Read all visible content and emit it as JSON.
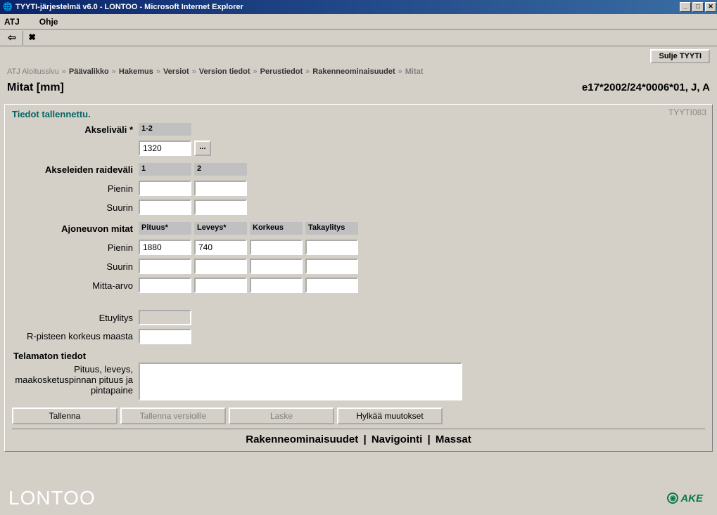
{
  "window": {
    "title": "TYYTI-järjestelmä v6.0 - LONTOO - Microsoft Internet Explorer"
  },
  "menu": {
    "atj": "ATJ",
    "ohje": "Ohje"
  },
  "top": {
    "sulje": "Sulje TYYTI"
  },
  "breadcrumb": {
    "items": [
      "ATJ Aloitussivu",
      "Päävalikko",
      "Hakemus",
      "Versiot",
      "Version tiedot",
      "Perustiedot",
      "Rakenneominaisuudet",
      "Mitat"
    ],
    "sep": "»"
  },
  "header": {
    "title": "Mitat [mm]",
    "code": "e17*2002/24*0006*01, J, A"
  },
  "panel": {
    "status": "Tiedot tallennettu.",
    "id": "TYYTI083",
    "akselivali": {
      "label": "Akseliväli *",
      "col1": "1-2",
      "value": "1320"
    },
    "raidevali": {
      "label": "Akseleiden raideväli",
      "col1": "1",
      "col2": "2",
      "pienin": "Pienin",
      "suurin": "Suurin"
    },
    "ajoneuvo": {
      "label": "Ajoneuvon mitat",
      "cols": {
        "pituus": "Pituus*",
        "leveys": "Leveys*",
        "korkeus": "Korkeus",
        "taka": "Takaylitys"
      },
      "rows": {
        "pienin": "Pienin",
        "suurin": "Suurin",
        "mitta": "Mitta-arvo"
      },
      "vals": {
        "pienin_pituus": "1880",
        "pienin_leveys": "740"
      }
    },
    "etuylitys": "Etuylitys",
    "rpiste": "R-pisteen korkeus maasta",
    "telamaton": {
      "head": "Telamaton tiedot",
      "label": "Pituus, leveys, maakosketuspinnan pituus ja pintapaine"
    },
    "buttons": {
      "tallenna": "Tallenna",
      "versioille": "Tallenna versioille",
      "laske": "Laske",
      "hylkaa": "Hylkää muutokset"
    },
    "bottom": {
      "rakenne": "Rakenneominaisuudet",
      "navi": "Navigointi",
      "massat": "Massat"
    }
  },
  "footer": {
    "logo": "LONTOO",
    "ake": "AKE"
  }
}
